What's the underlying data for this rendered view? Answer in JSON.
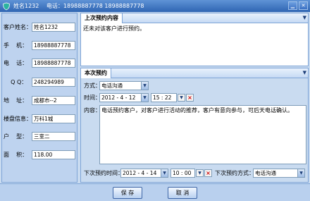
{
  "window": {
    "name": "姓名1232",
    "phones": "电话：18988887778  18988887778"
  },
  "customer": {
    "fields": [
      {
        "label": "客户姓名：",
        "value": "姓名1232"
      },
      {
        "label": "手    机：",
        "value": "18988887778"
      },
      {
        "label": "电    话：",
        "value": "18988887778"
      },
      {
        "label": "    Q Q：",
        "value": "248294989"
      },
      {
        "label": "地    址：",
        "value": "成都市--2"
      },
      {
        "label": "楼盘信息：",
        "value": "万科1城"
      },
      {
        "label": "户    型：",
        "value": "三室二"
      },
      {
        "label": "面    积：",
        "value": "118.00"
      }
    ]
  },
  "previous": {
    "header": "上次预约内容",
    "content": "还未对该客户进行预约。"
  },
  "current": {
    "header": "本次预约",
    "method_label": "方式：",
    "method_value": "电话沟通",
    "time_label": "时间：",
    "date_value": "2012 - 4 - 12",
    "clock_value": "15 : 22",
    "content_label": "内容：",
    "content_value": "电话预约客户，对客户进行活动的推荐，客户有意向参与，可后天电话确认。",
    "next_time_label": "下次预约时间：",
    "next_date_value": "2012 - 4 - 14",
    "next_clock_value": "10 : 00",
    "next_method_label": "下次预约方式：",
    "next_method_value": "电话沟通"
  },
  "buttons": {
    "save": "保 存",
    "cancel": "取 消"
  }
}
